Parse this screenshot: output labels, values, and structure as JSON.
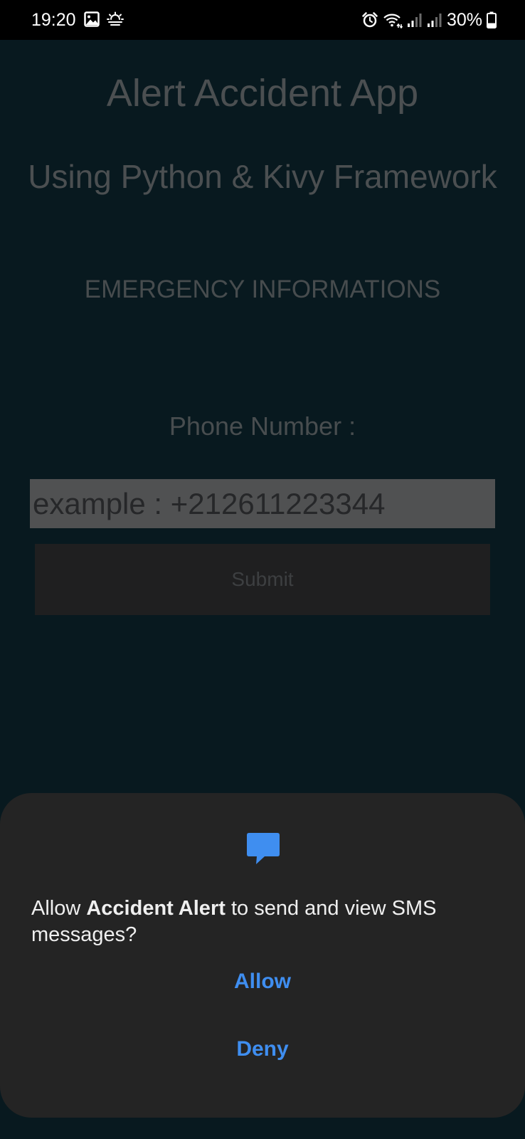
{
  "status_bar": {
    "time": "19:20",
    "left_icons": [
      "gallery-icon",
      "weather-icon"
    ],
    "right_icons": [
      "alarm-icon",
      "wifi-icon",
      "signal-icon",
      "signal-icon",
      "battery-icon"
    ],
    "battery": "30%"
  },
  "app": {
    "title": "Alert Accident App",
    "subtitle": "Using Python & Kivy Framework",
    "section_heading": "EMERGENCY INFORMATIONS",
    "phone_label": "Phone Number :",
    "phone_placeholder": "example : +212611223344",
    "phone_value": "",
    "submit_label": "Submit"
  },
  "dialog": {
    "icon": "message-icon",
    "message_prefix": "Allow ",
    "app_name": "Accident Alert",
    "message_suffix": " to send and view SMS messages?",
    "allow_label": "Allow",
    "deny_label": "Deny"
  },
  "colors": {
    "background": "#08191f",
    "status_bar": "#000000",
    "dialog_background": "#242424",
    "accent": "#3f8ef0",
    "input_background": "#505152",
    "button_background": "#1f1f20"
  }
}
